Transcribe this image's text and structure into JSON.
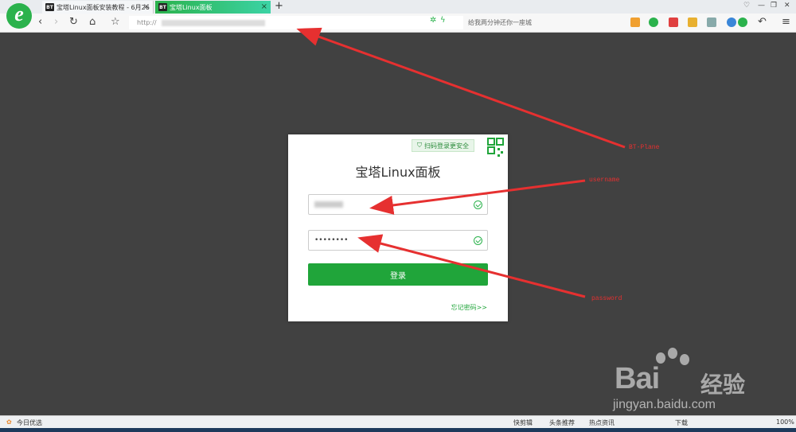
{
  "tabs": [
    {
      "label": "宝塔Linux面板安装教程 - 6月26",
      "icon": "BT"
    },
    {
      "label": "宝塔Linux面板",
      "icon": "BT"
    }
  ],
  "address": {
    "prefix": "http://"
  },
  "search": {
    "placeholder": "给我两分钟还你一座城"
  },
  "login": {
    "qr_badge": "扫码登录更安全",
    "title": "宝塔Linux面板",
    "password_mask": "••••••••",
    "button": "登录",
    "forgot": "忘记密码>>"
  },
  "annotations": {
    "plane": "BT-Plane",
    "username": "username",
    "password": "password"
  },
  "watermark": {
    "brand": "Bai",
    "brand2": "经验",
    "url": "jingyan.baidu.com"
  },
  "statusbar": {
    "left": "今日优选",
    "items": [
      "快剪辑",
      "头条推荐",
      "热点资讯",
      "下载",
      "100%"
    ]
  },
  "colors": {
    "accent": "#20a53a",
    "annotation": "#e63030",
    "background": "#414141"
  }
}
